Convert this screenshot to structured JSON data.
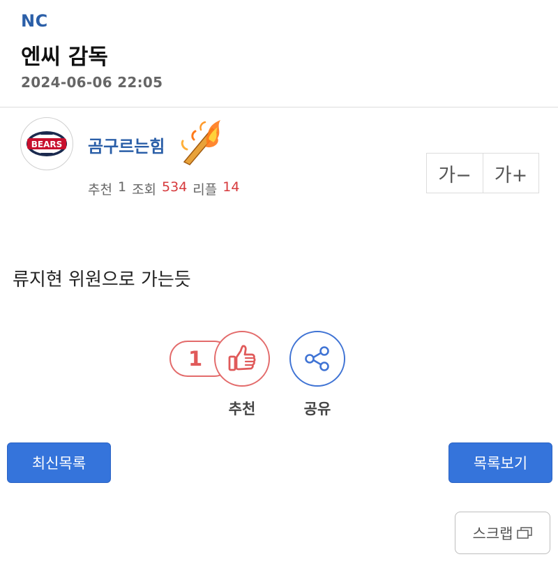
{
  "post": {
    "category": "NC",
    "title": "엔씨 감독",
    "date": "2024-06-06 22:05",
    "author": "곰구르는힘",
    "body": "류지현 위원으로 가는듯"
  },
  "stats": {
    "recommend_label": "추천",
    "recommend_value": "1",
    "views_label": "조회",
    "views_value": "534",
    "replies_label": "리플",
    "replies_value": "14"
  },
  "avatar": {
    "text": "BEARS",
    "icon": "bears-logo-icon"
  },
  "font_controls": {
    "decrease": "가−",
    "increase": "가+"
  },
  "actions": {
    "recommend_count": "1",
    "recommend_label": "추천",
    "share_label": "공유"
  },
  "buttons": {
    "latest_list": "최신목록",
    "view_list": "목록보기",
    "scrap": "스크랩"
  },
  "colors": {
    "brand_blue": "#2b5fa8",
    "button_blue": "#3574db",
    "recommend_red": "#e36b6b",
    "share_blue": "#3f73d4",
    "stat_red": "#d6393c"
  }
}
